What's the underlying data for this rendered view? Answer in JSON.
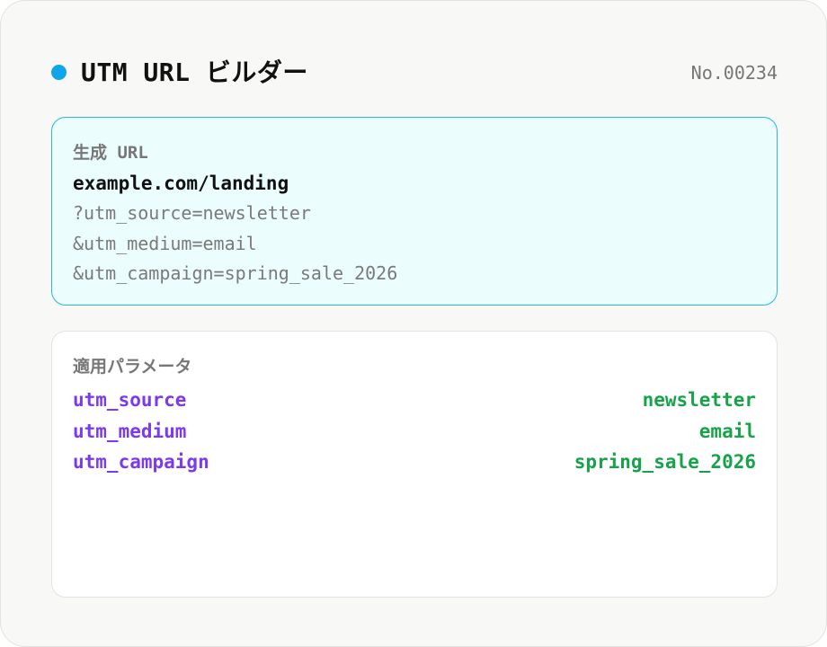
{
  "header": {
    "title": "UTM URL ビルダー",
    "doc_number": "No.00234",
    "status_dot_color": "#0ea5e9"
  },
  "generated_url": {
    "label": "生成 URL",
    "base": "example.com/landing",
    "query_lines": [
      "?utm_source=newsletter",
      "&utm_medium=email",
      "&utm_campaign=spring_sale_2026"
    ],
    "border_color": "#2bb3e3",
    "background_color": "#ebfdfd"
  },
  "parameters": {
    "label": "適用パラメータ",
    "rows": [
      {
        "key": "utm_source",
        "value": "newsletter"
      },
      {
        "key": "utm_medium",
        "value": "email"
      },
      {
        "key": "utm_campaign",
        "value": "spring_sale_2026"
      }
    ],
    "key_color": "#7c3aed",
    "value_color": "#16a34a"
  }
}
